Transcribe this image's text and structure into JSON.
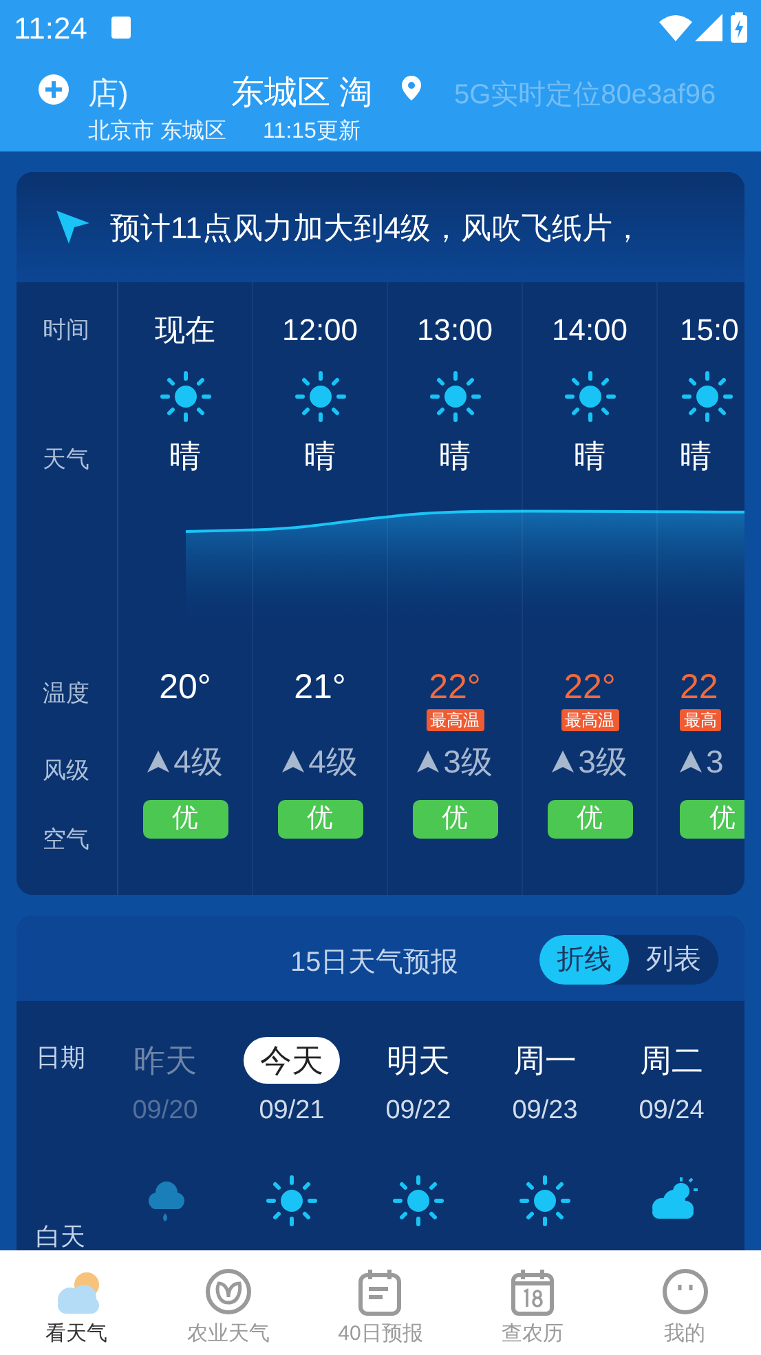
{
  "status_bar": {
    "time": "11:24"
  },
  "header": {
    "left_fragment": "店)",
    "title": "东城区 淘",
    "location_hint": "5G实时定位80e3af96",
    "subtitle": "北京市 东城区",
    "updated": "11:15更新"
  },
  "alert": {
    "text": "预计11点风力加大到4级，风吹飞纸片，"
  },
  "hourly": {
    "labels": [
      "时间",
      "天气",
      "温度",
      "风级",
      "空气"
    ],
    "hours": [
      {
        "time": "现在",
        "condition": "晴",
        "temp": "20°",
        "high": false,
        "wind": "4级",
        "air": "优"
      },
      {
        "time": "12:00",
        "condition": "晴",
        "temp": "21°",
        "high": false,
        "wind": "4级",
        "air": "优"
      },
      {
        "time": "13:00",
        "condition": "晴",
        "temp": "22°",
        "high": true,
        "badge": "最高温",
        "wind": "3级",
        "air": "优"
      },
      {
        "time": "14:00",
        "condition": "晴",
        "temp": "22°",
        "high": true,
        "badge": "最高温",
        "wind": "3级",
        "air": "优"
      },
      {
        "time": "15:0",
        "condition": "晴",
        "temp": "22",
        "high": true,
        "badge": "最高",
        "wind": "3",
        "air": "优"
      }
    ]
  },
  "forecast": {
    "title": "15日天气预报",
    "modes": [
      {
        "label": "折线",
        "selected": true
      },
      {
        "label": "列表",
        "selected": false
      }
    ],
    "labels": [
      "日期",
      "白天"
    ],
    "days": [
      {
        "day": "昨天",
        "date": "09/20",
        "kind": "rain",
        "past": true,
        "selected": false
      },
      {
        "day": "今天",
        "date": "09/21",
        "kind": "sunny",
        "past": false,
        "selected": true
      },
      {
        "day": "明天",
        "date": "09/22",
        "kind": "sunny",
        "past": false,
        "selected": false
      },
      {
        "day": "周一",
        "date": "09/23",
        "kind": "sunny",
        "past": false,
        "selected": false
      },
      {
        "day": "周二",
        "date": "09/24",
        "kind": "partly_cloudy",
        "past": false,
        "selected": false
      }
    ]
  },
  "nav": [
    {
      "label": "看天气",
      "kind": "weather",
      "selected": true
    },
    {
      "label": "农业天气",
      "kind": "leaf",
      "selected": false
    },
    {
      "label": "40日预报",
      "kind": "calendar",
      "selected": false
    },
    {
      "label": "查农历",
      "kind": "calendar18",
      "selected": false
    },
    {
      "label": "我的",
      "kind": "face",
      "selected": false
    }
  ]
}
